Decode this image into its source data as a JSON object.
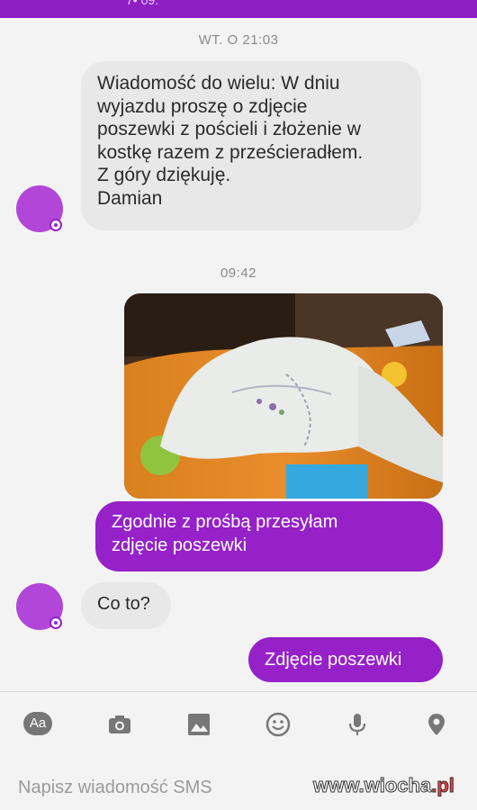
{
  "status_bar": {
    "clock_partial": "7• 09:"
  },
  "timestamps": {
    "first": "WT. O 21:03",
    "second": "09:42"
  },
  "messages": {
    "incoming_1": [
      "Wiadomość do wielu: W dniu",
      "wyjazdu proszę o zdjęcie",
      "poszewki z pościeli i złożenie w",
      "kostkę razem z prześcieradłem.",
      "Z góry dziękuję.",
      "Damian"
    ],
    "outgoing_1": [
      "Zgodnie z prośbą przesyłam",
      "zdjęcie poszewki"
    ],
    "incoming_2": "Co to?",
    "outgoing_2": "Zdjęcie poszewki"
  },
  "toolbar": {
    "aa_label": "Aa",
    "icons": [
      "camera-icon",
      "image-icon",
      "emoji-icon",
      "microphone-icon",
      "location-icon"
    ]
  },
  "composer": {
    "placeholder": "Napisz wiadomość SMS"
  },
  "watermark": {
    "text": "www.wiocha",
    "tld": ".pl"
  },
  "colors": {
    "accent": "#9621c9",
    "incoming_bubble": "#e8e8e8",
    "background": "#f3f3f3"
  }
}
